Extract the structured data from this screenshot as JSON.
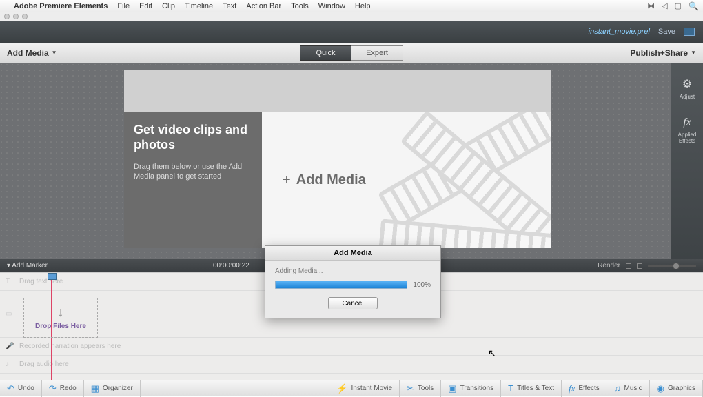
{
  "menubar": {
    "app": "Adobe Premiere Elements",
    "items": [
      "File",
      "Edit",
      "Clip",
      "Timeline",
      "Text",
      "Action Bar",
      "Tools",
      "Window",
      "Help"
    ]
  },
  "titlebar": {
    "project": "instant_movie.prel",
    "save": "Save"
  },
  "toolbar": {
    "add_media": "Add Media",
    "quick": "Quick",
    "expert": "Expert",
    "publish": "Publish+Share"
  },
  "stage": {
    "heading": "Get video clips and photos",
    "sub": "Drag them below or use the Add Media panel to get started",
    "add_media_btn": "Add Media",
    "plus": "+"
  },
  "side_panel": {
    "adjust": "Adjust",
    "effects": "Applied Effects"
  },
  "timeline_header": {
    "marker": "Add Marker",
    "timecode": "00:00:00:22",
    "render": "Render"
  },
  "timeline": {
    "track1": "Drag text here",
    "drop_label": "Drop Files Here",
    "track3": "Recorded narration appears here",
    "track4": "Drag audio here"
  },
  "action_bar": {
    "undo": "Undo",
    "redo": "Redo",
    "organizer": "Organizer",
    "instant_movie": "Instant Movie",
    "tools": "Tools",
    "transitions": "Transitions",
    "titles": "Titles & Text",
    "effects": "Effects",
    "music": "Music",
    "graphics": "Graphics"
  },
  "modal": {
    "title": "Add Media",
    "status": "Adding Media...",
    "percent": "100%",
    "cancel": "Cancel"
  }
}
